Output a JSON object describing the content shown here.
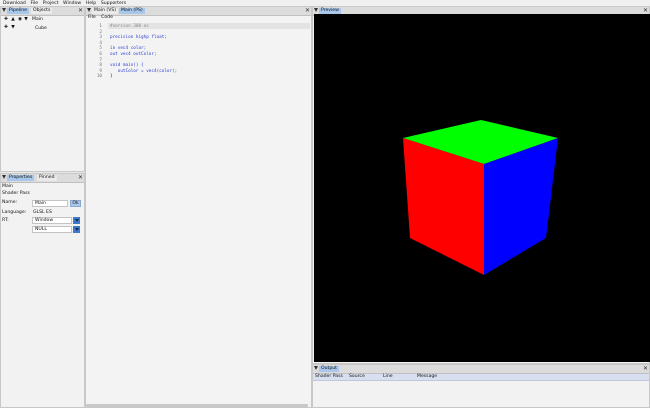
{
  "menu": [
    "Download",
    "File",
    "Project",
    "Window",
    "Help",
    "Supporters"
  ],
  "left_panel": {
    "tabs": [
      "Pipeline",
      "Objects"
    ],
    "tree": [
      {
        "label": "Main"
      },
      {
        "label": "Cube"
      }
    ]
  },
  "properties": {
    "tabs": [
      "Properties",
      "Pinned"
    ],
    "title": "Main",
    "subtitle": "Shader Pass",
    "name_label": "Name:",
    "name_value": "Main",
    "ok_label": "Ok",
    "language_label": "Language:",
    "language_value": "GLSL ES",
    "rt_label": "RT:",
    "rt_value_1": "Window",
    "rt_value_2": "NULL"
  },
  "editor": {
    "tabs": [
      "Main (VS)",
      "Main (PS)"
    ],
    "menu": [
      "File",
      "Code"
    ],
    "lines": [
      {
        "n": "1",
        "text": "#version 300 es"
      },
      {
        "n": "2",
        "text": ""
      },
      {
        "n": "3",
        "text": "precision highp float;"
      },
      {
        "n": "4",
        "text": ""
      },
      {
        "n": "5",
        "text": "in vec4 color;"
      },
      {
        "n": "6",
        "text": "out vec4 outColor;"
      },
      {
        "n": "7",
        "text": ""
      },
      {
        "n": "8",
        "text": "void main() {"
      },
      {
        "n": "9",
        "text": "   outColor = vec4(color);"
      },
      {
        "n": "10",
        "text": "}"
      }
    ]
  },
  "preview": {
    "tab": "Preview",
    "cube_colors": {
      "top": "#00ff00",
      "left": "#ff0000",
      "right": "#0000ff"
    }
  },
  "output": {
    "tab": "Output",
    "columns": [
      "Shader Pass",
      "Source",
      "Line",
      "Message"
    ]
  },
  "colors": {
    "accent": "#a9c7ea",
    "viewport": "#000000"
  }
}
